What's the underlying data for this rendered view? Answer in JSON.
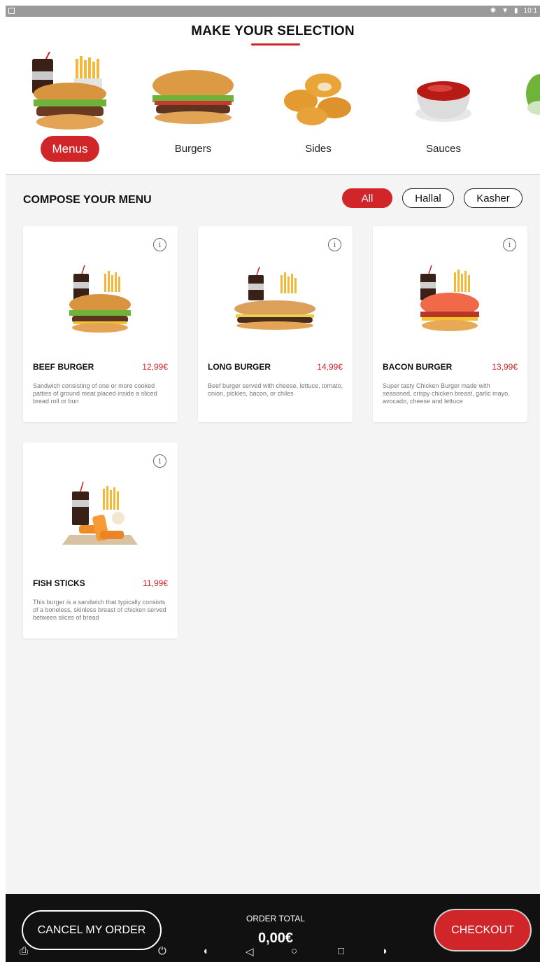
{
  "status_bar": {
    "time": "10:1"
  },
  "header": {
    "title": "MAKE YOUR SELECTION"
  },
  "categories": [
    {
      "label": "Menus",
      "active": true
    },
    {
      "label": "Burgers",
      "active": false
    },
    {
      "label": "Sides",
      "active": false
    },
    {
      "label": "Sauces",
      "active": false
    }
  ],
  "section": {
    "title": "COMPOSE YOUR MENU"
  },
  "filters": [
    "All",
    "Hallal",
    "Kasher"
  ],
  "active_filter": "All",
  "products": [
    {
      "name": "BEEF BURGER",
      "price": "12,99€",
      "description": "Sandwich consisting of one or more cooked patties of ground meat placed inside a sliced bread roll or bun"
    },
    {
      "name": "LONG BURGER",
      "price": "14,99€",
      "description": "Beef burger served with cheese, lettuce, tomato, onion, pickles, bacon, or chiles"
    },
    {
      "name": "BACON BURGER",
      "price": "13,99€",
      "description": "Super tasty Chicken Burger made with seasoned, crispy chicken breast, garlic mayo, avocado, cheese and lettuce"
    },
    {
      "name": "FISH STICKS",
      "price": "11,99€",
      "description": "This burger is a sandwich that typically consists of a boneless, skinless breast of chicken served between slices of bread"
    }
  ],
  "footer": {
    "cancel_label": "CANCEL MY ORDER",
    "total_label": "ORDER TOTAL",
    "total_value": "0,00€",
    "checkout_label": "CHECKOUT"
  },
  "colors": {
    "accent": "#d0262a",
    "footer_bg": "#111111",
    "page_bg": "#f4f4f4"
  },
  "icons": [
    "info-icon",
    "power-icon",
    "volume-down-icon",
    "back-icon",
    "home-icon",
    "recents-icon",
    "volume-up-icon",
    "screenshot-icon"
  ]
}
